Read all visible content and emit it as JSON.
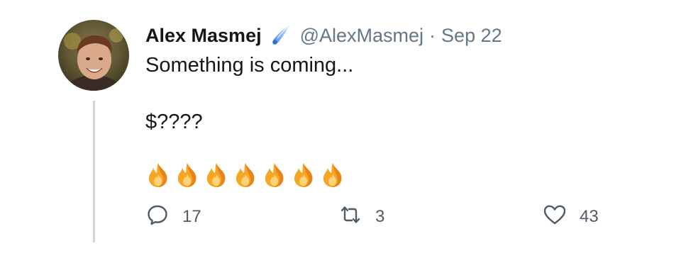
{
  "tweet": {
    "author_name": "Alex Masmej",
    "handle": "@AlexMasmej",
    "separator": "·",
    "date": "Sep 22",
    "text_line1": "Something is coming...",
    "text_line2": "$????",
    "fire_emoji_count": 7,
    "badge_icon": "comet-icon",
    "colors": {
      "name": "#14171a",
      "secondary": "#657786",
      "thread_line": "#cfd9de",
      "badge": "#6ba6f2"
    }
  },
  "actions": {
    "reply": {
      "icon": "reply-icon",
      "count": "17"
    },
    "retweet": {
      "icon": "retweet-icon",
      "count": "3"
    },
    "like": {
      "icon": "heart-icon",
      "count": "43"
    }
  }
}
